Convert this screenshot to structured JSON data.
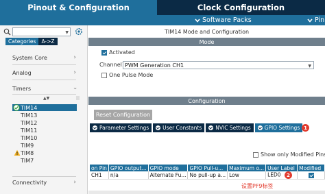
{
  "tabs": {
    "pinout": "Pinout & Configuration",
    "clock": "Clock Configuration"
  },
  "subbar": {
    "software_packs": "Software Packs",
    "pinout_partial": "Pin"
  },
  "sidebar": {
    "category_tabs": [
      "Categories",
      "A->Z"
    ],
    "categories": [
      "System Core",
      "Analog",
      "Timers",
      "Connectivity"
    ],
    "peripherals": [
      {
        "label": "TIM14",
        "status": "ok",
        "selected": true
      },
      {
        "label": "TIM13",
        "status": "none"
      },
      {
        "label": "TIM12",
        "status": "none"
      },
      {
        "label": "TIM11",
        "status": "none"
      },
      {
        "label": "TIM10",
        "status": "none"
      },
      {
        "label": "TIM9",
        "status": "none"
      },
      {
        "label": "TIM8",
        "status": "warning"
      },
      {
        "label": "TIM7",
        "status": "none"
      }
    ]
  },
  "panel": {
    "title": "TIM14 Mode and Configuration",
    "mode_header": "Mode",
    "activated_label": "Activated",
    "activated_checked": true,
    "channel_label": "Channel1",
    "channel_value": "PWM Generation CH1",
    "one_pulse_label": "One Pulse Mode",
    "one_pulse_checked": false,
    "config_header": "Configuration",
    "reset_button": "Reset Configuration",
    "config_tabs": [
      "Parameter Settings",
      "User Constants",
      "NVIC Settings",
      "GPIO Settings"
    ],
    "active_tab": "GPIO Settings",
    "badge_1": "1",
    "show_modified_label": "Show only Modified Pins",
    "table": {
      "headers": [
        "on Pin",
        "GPIO output...",
        "GPIO mode",
        "GPIO Pull-u...",
        "Maximum o...",
        "User Label",
        "Modified"
      ],
      "rows": [
        [
          "CH1",
          "n/a",
          "Alternate Fu...",
          "No pull-up a...",
          "Low",
          "LED0",
          "checked"
        ]
      ]
    },
    "badge_2": "2",
    "annotation": "设置PF9标签"
  },
  "colors": {
    "brand_blue": "#1f6f9c",
    "dark_navy": "#0b2a45",
    "section_gray": "#6f7f8c",
    "badge_red": "#e23b2e"
  }
}
